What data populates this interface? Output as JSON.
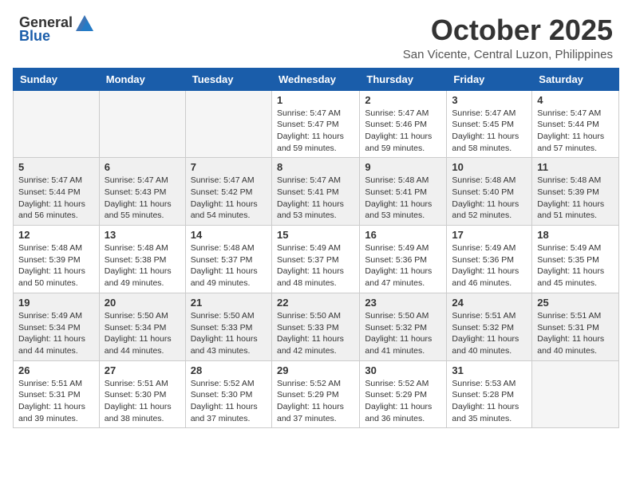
{
  "logo": {
    "general": "General",
    "blue": "Blue"
  },
  "title": "October 2025",
  "subtitle": "San Vicente, Central Luzon, Philippines",
  "days_of_week": [
    "Sunday",
    "Monday",
    "Tuesday",
    "Wednesday",
    "Thursday",
    "Friday",
    "Saturday"
  ],
  "weeks": [
    [
      {
        "day": "",
        "info": ""
      },
      {
        "day": "",
        "info": ""
      },
      {
        "day": "",
        "info": ""
      },
      {
        "day": "1",
        "info": "Sunrise: 5:47 AM\nSunset: 5:47 PM\nDaylight: 11 hours\nand 59 minutes."
      },
      {
        "day": "2",
        "info": "Sunrise: 5:47 AM\nSunset: 5:46 PM\nDaylight: 11 hours\nand 59 minutes."
      },
      {
        "day": "3",
        "info": "Sunrise: 5:47 AM\nSunset: 5:45 PM\nDaylight: 11 hours\nand 58 minutes."
      },
      {
        "day": "4",
        "info": "Sunrise: 5:47 AM\nSunset: 5:44 PM\nDaylight: 11 hours\nand 57 minutes."
      }
    ],
    [
      {
        "day": "5",
        "info": "Sunrise: 5:47 AM\nSunset: 5:44 PM\nDaylight: 11 hours\nand 56 minutes."
      },
      {
        "day": "6",
        "info": "Sunrise: 5:47 AM\nSunset: 5:43 PM\nDaylight: 11 hours\nand 55 minutes."
      },
      {
        "day": "7",
        "info": "Sunrise: 5:47 AM\nSunset: 5:42 PM\nDaylight: 11 hours\nand 54 minutes."
      },
      {
        "day": "8",
        "info": "Sunrise: 5:47 AM\nSunset: 5:41 PM\nDaylight: 11 hours\nand 53 minutes."
      },
      {
        "day": "9",
        "info": "Sunrise: 5:48 AM\nSunset: 5:41 PM\nDaylight: 11 hours\nand 53 minutes."
      },
      {
        "day": "10",
        "info": "Sunrise: 5:48 AM\nSunset: 5:40 PM\nDaylight: 11 hours\nand 52 minutes."
      },
      {
        "day": "11",
        "info": "Sunrise: 5:48 AM\nSunset: 5:39 PM\nDaylight: 11 hours\nand 51 minutes."
      }
    ],
    [
      {
        "day": "12",
        "info": "Sunrise: 5:48 AM\nSunset: 5:39 PM\nDaylight: 11 hours\nand 50 minutes."
      },
      {
        "day": "13",
        "info": "Sunrise: 5:48 AM\nSunset: 5:38 PM\nDaylight: 11 hours\nand 49 minutes."
      },
      {
        "day": "14",
        "info": "Sunrise: 5:48 AM\nSunset: 5:37 PM\nDaylight: 11 hours\nand 49 minutes."
      },
      {
        "day": "15",
        "info": "Sunrise: 5:49 AM\nSunset: 5:37 PM\nDaylight: 11 hours\nand 48 minutes."
      },
      {
        "day": "16",
        "info": "Sunrise: 5:49 AM\nSunset: 5:36 PM\nDaylight: 11 hours\nand 47 minutes."
      },
      {
        "day": "17",
        "info": "Sunrise: 5:49 AM\nSunset: 5:36 PM\nDaylight: 11 hours\nand 46 minutes."
      },
      {
        "day": "18",
        "info": "Sunrise: 5:49 AM\nSunset: 5:35 PM\nDaylight: 11 hours\nand 45 minutes."
      }
    ],
    [
      {
        "day": "19",
        "info": "Sunrise: 5:49 AM\nSunset: 5:34 PM\nDaylight: 11 hours\nand 44 minutes."
      },
      {
        "day": "20",
        "info": "Sunrise: 5:50 AM\nSunset: 5:34 PM\nDaylight: 11 hours\nand 44 minutes."
      },
      {
        "day": "21",
        "info": "Sunrise: 5:50 AM\nSunset: 5:33 PM\nDaylight: 11 hours\nand 43 minutes."
      },
      {
        "day": "22",
        "info": "Sunrise: 5:50 AM\nSunset: 5:33 PM\nDaylight: 11 hours\nand 42 minutes."
      },
      {
        "day": "23",
        "info": "Sunrise: 5:50 AM\nSunset: 5:32 PM\nDaylight: 11 hours\nand 41 minutes."
      },
      {
        "day": "24",
        "info": "Sunrise: 5:51 AM\nSunset: 5:32 PM\nDaylight: 11 hours\nand 40 minutes."
      },
      {
        "day": "25",
        "info": "Sunrise: 5:51 AM\nSunset: 5:31 PM\nDaylight: 11 hours\nand 40 minutes."
      }
    ],
    [
      {
        "day": "26",
        "info": "Sunrise: 5:51 AM\nSunset: 5:31 PM\nDaylight: 11 hours\nand 39 minutes."
      },
      {
        "day": "27",
        "info": "Sunrise: 5:51 AM\nSunset: 5:30 PM\nDaylight: 11 hours\nand 38 minutes."
      },
      {
        "day": "28",
        "info": "Sunrise: 5:52 AM\nSunset: 5:30 PM\nDaylight: 11 hours\nand 37 minutes."
      },
      {
        "day": "29",
        "info": "Sunrise: 5:52 AM\nSunset: 5:29 PM\nDaylight: 11 hours\nand 37 minutes."
      },
      {
        "day": "30",
        "info": "Sunrise: 5:52 AM\nSunset: 5:29 PM\nDaylight: 11 hours\nand 36 minutes."
      },
      {
        "day": "31",
        "info": "Sunrise: 5:53 AM\nSunset: 5:28 PM\nDaylight: 11 hours\nand 35 minutes."
      },
      {
        "day": "",
        "info": ""
      }
    ]
  ]
}
